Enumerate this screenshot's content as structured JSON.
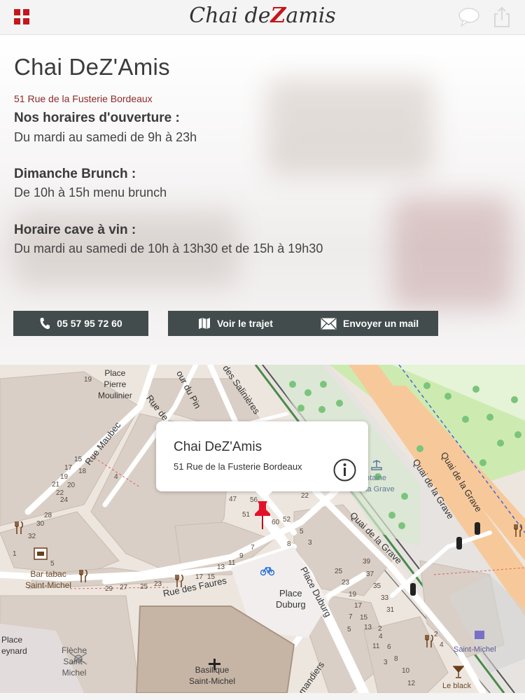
{
  "header": {
    "logo_text_left": "Chai de",
    "logo_text_z": "Z",
    "logo_text_right": "amis"
  },
  "info": {
    "title": "Chai DeZ'Amis",
    "address": "51 Rue de la Fusterie Bordeaux",
    "sections": [
      {
        "label": "Nos horaires d'ouverture :",
        "value": "Du mardi au samedi de 9h à 23h"
      },
      {
        "label": "Dimanche Brunch :",
        "value": "De 10h à 15h menu brunch"
      },
      {
        "label": "Horaire cave à vin :",
        "value": "Du mardi au samedi de 10h à 13h30 et de 15h à 19h30"
      }
    ]
  },
  "actions": {
    "phone_label": "05 57 95 72 60",
    "route_label": "Voir le trajet",
    "mail_label": "Envoyer un mail"
  },
  "map": {
    "popup_title": "Chai DeZ'Amis",
    "popup_address": "51 Rue de la Fusterie Bordeaux",
    "labels": {
      "place_pierre": "Place\nPierre\nMoulinier",
      "place_duburg": "Place\nDuburg",
      "bar_tabac": "Bar tabac\nSaint-Michel",
      "fleche": "Flèche\nSaint-\nMichel",
      "basilique": "Basilique\nSaint-Michel",
      "place_meynard": "Place\neynard",
      "fontaine": "ntaine\nla Grave",
      "saint_michel": "Saint-Michel",
      "le_black": "Le black"
    },
    "roads": {
      "rue_maubec": "Rue Maubec",
      "rue_de": "Rue de",
      "cour_du_pin": "our du Pin",
      "des_salinieres": "des Salinières",
      "rue_des_faures": "Rue des Faures",
      "place_duburg_road": "Place Duburg",
      "quai_grave_1": "Quai de la Grave",
      "quai_grave_2": "Quai de la Grave",
      "quai_grave_3": "Quai de la Grave",
      "mandiers": "mandiers"
    },
    "numbers": [
      "19",
      "15",
      "17",
      "18",
      "19",
      "21",
      "20",
      "22",
      "24",
      "4",
      "28",
      "30",
      "32",
      "1",
      "5",
      "29",
      "27",
      "25",
      "23",
      "17",
      "15",
      "13",
      "11",
      "9",
      "7",
      "47",
      "56",
      "51",
      "60",
      "52",
      "5",
      "3",
      "8",
      "22",
      "39",
      "37",
      "25",
      "35",
      "23",
      "33",
      "19",
      "31",
      "17",
      "15",
      "13",
      "11",
      "7",
      "5",
      "3",
      "2",
      "4",
      "6",
      "8",
      "10",
      "12",
      "2",
      "4"
    ]
  },
  "colors": {
    "button_bg": "#424c4c",
    "accent_red": "#c4161c",
    "address_red": "#8a2a2a",
    "quay_orange": "#f7c99a",
    "green_area": "#cdebb0"
  }
}
